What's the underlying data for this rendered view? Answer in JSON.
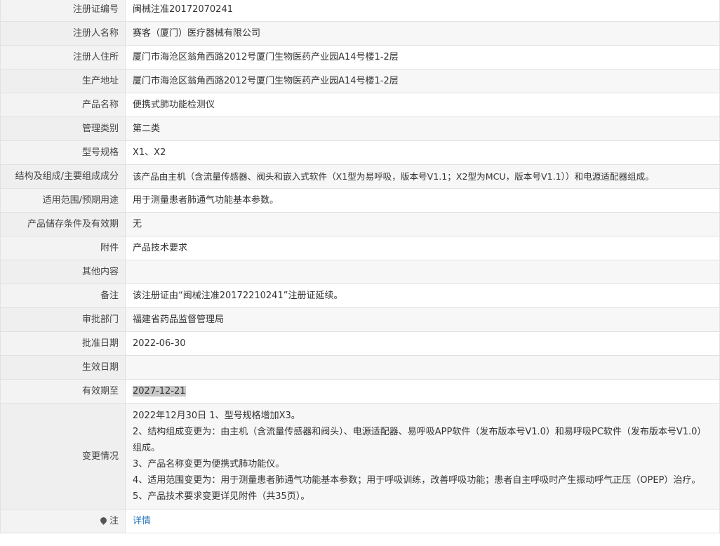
{
  "rows": [
    {
      "label": "注册证编号",
      "value": "闽械注准20172070241"
    },
    {
      "label": "注册人名称",
      "value": "赛客（厦门）医疗器械有限公司"
    },
    {
      "label": "注册人住所",
      "value": "厦门市海沧区翁角西路2012号厦门生物医药产业园A14号楼1-2层"
    },
    {
      "label": "生产地址",
      "value": "厦门市海沧区翁角西路2012号厦门生物医药产业园A14号楼1-2层"
    },
    {
      "label": "产品名称",
      "value": "便携式肺功能检测仪"
    },
    {
      "label": "管理类别",
      "value": "第二类"
    },
    {
      "label": "型号规格",
      "value": "X1、X2"
    },
    {
      "label": "结构及组成/主要组成成分",
      "value": "该产品由主机（含流量传感器、阀头和嵌入式软件（X1型为易呼吸，版本号V1.1；X2型为MCU，版本号V1.1））和电源适配器组成。"
    },
    {
      "label": "适用范围/预期用途",
      "value": "用于测量患者肺通气功能基本参数。"
    },
    {
      "label": "产品储存条件及有效期",
      "value": "无"
    },
    {
      "label": "附件",
      "value": "产品技术要求"
    },
    {
      "label": "其他内容",
      "value": ""
    },
    {
      "label": "备注",
      "value": "该注册证由“闽械注准20172210241”注册证延续。"
    },
    {
      "label": "审批部门",
      "value": "福建省药品监督管理局"
    },
    {
      "label": "批准日期",
      "value": "2022-06-30"
    },
    {
      "label": "生效日期",
      "value": ""
    },
    {
      "label": "有效期至",
      "value": "2027-12-21"
    }
  ],
  "changes": {
    "label": "变更情况",
    "lines": [
      "2022年12月30日 1、型号规格增加X3。",
      "2、结构组成变更为：由主机（含流量传感器和阀头）、电源适配器、易呼吸APP软件（发布版本号V1.0）和易呼吸PC软件（发布版本号V1.0）组成。",
      "3、产品名称变更为便携式肺功能仪。",
      "4、适用范围变更为：用于测量患者肺通气功能基本参数；用于呼吸训练，改善呼吸功能；患者自主呼吸时产生振动呼气正压（OPEP）治疗。",
      "5、产品技术要求变更详见附件（共35页）。"
    ]
  },
  "note": {
    "label": "注",
    "icon": "map-pin-icon",
    "link_text": "详情"
  }
}
